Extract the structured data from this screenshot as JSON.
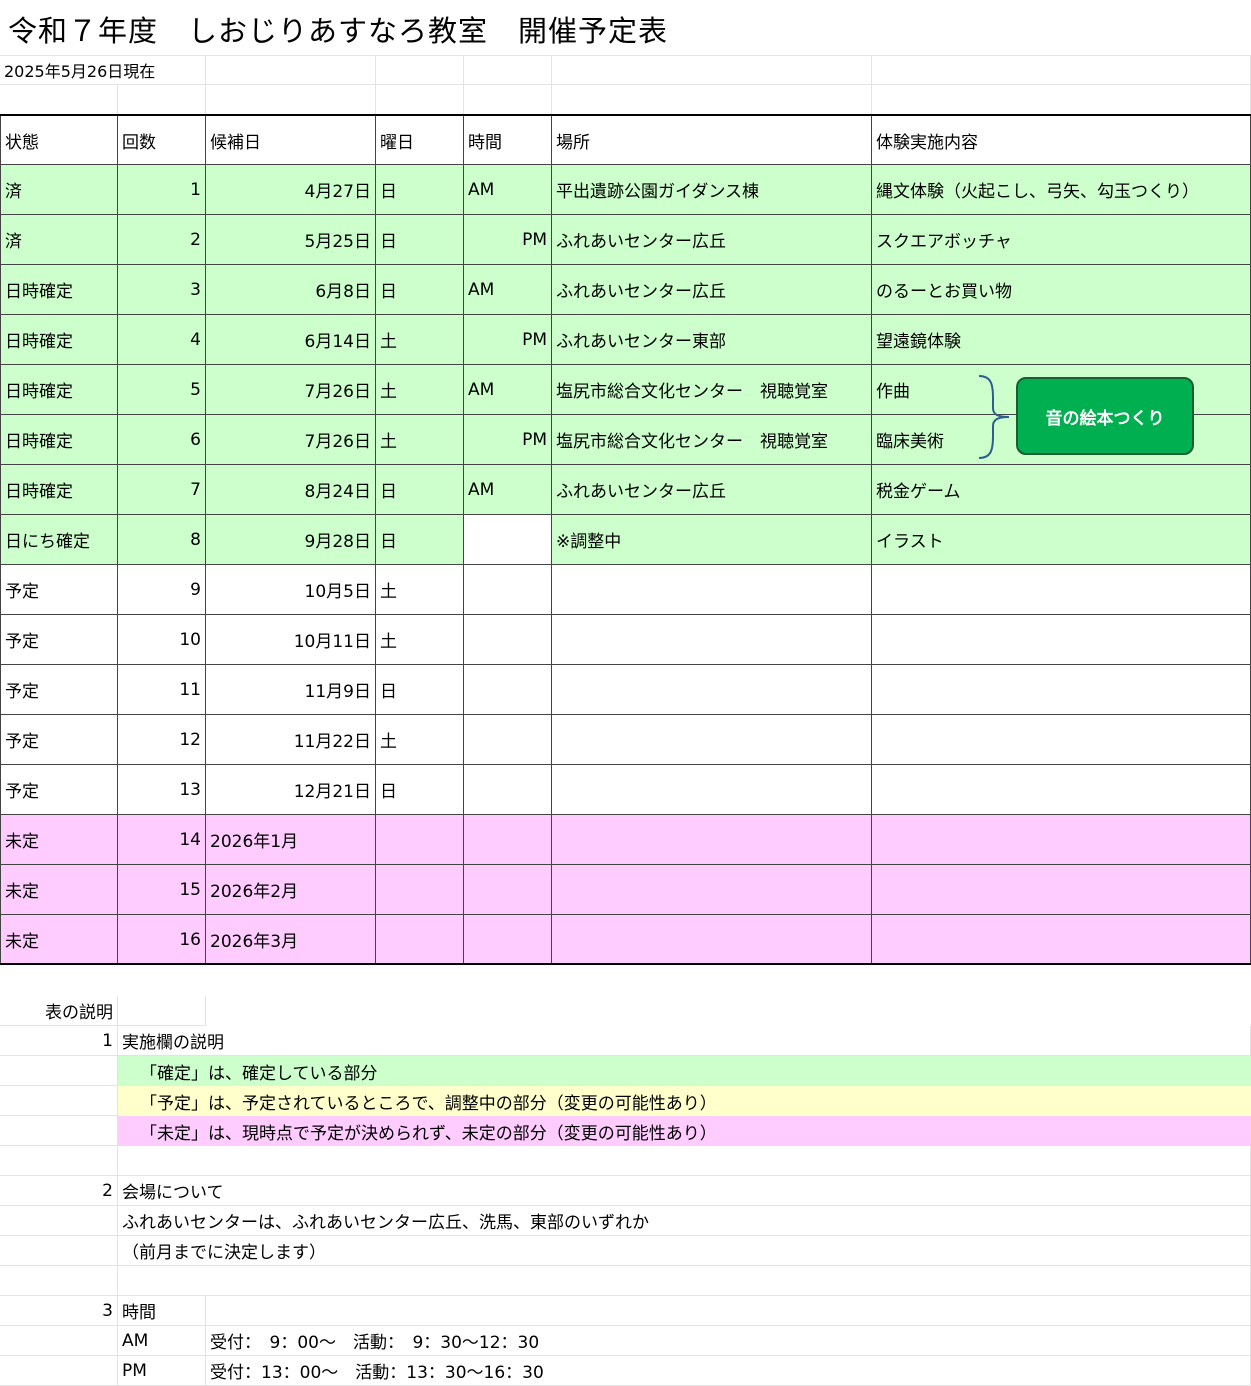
{
  "title": "令和７年度　しおじりあすなろ教室　開催予定表",
  "as_of": "2025年5月26日現在",
  "headers": [
    "状態",
    "回数",
    "候補日",
    "曜日",
    "時間",
    "場所",
    "体験実施内容"
  ],
  "rows": [
    {
      "status": "済",
      "no": "1",
      "date": "4月27日",
      "dow": "日",
      "am": "AM",
      "pm": "",
      "place": "平出遺跡公園ガイダンス棟",
      "content": "縄文体験（火起こし、弓矢、勾玉つくり）",
      "color": "green"
    },
    {
      "status": "済",
      "no": "2",
      "date": "5月25日",
      "dow": "日",
      "am": "",
      "pm": "PM",
      "place": "ふれあいセンター広丘",
      "content": "スクエアボッチャ",
      "color": "green"
    },
    {
      "status": "日時確定",
      "no": "3",
      "date": "6月8日",
      "dow": "日",
      "am": "AM",
      "pm": "",
      "place": "ふれあいセンター広丘",
      "content": "のるーとお買い物",
      "color": "green"
    },
    {
      "status": "日時確定",
      "no": "4",
      "date": "6月14日",
      "dow": "土",
      "am": "",
      "pm": "PM",
      "place": "ふれあいセンター東部",
      "content": "望遠鏡体験",
      "color": "green"
    },
    {
      "status": "日時確定",
      "no": "5",
      "date": "7月26日",
      "dow": "土",
      "am": "AM",
      "pm": "",
      "place": "塩尻市総合文化センター　視聴覚室",
      "content": "作曲",
      "color": "green"
    },
    {
      "status": "日時確定",
      "no": "6",
      "date": "7月26日",
      "dow": "土",
      "am": "",
      "pm": "PM",
      "place": "塩尻市総合文化センター　視聴覚室",
      "content": "臨床美術",
      "color": "green"
    },
    {
      "status": "日時確定",
      "no": "7",
      "date": "8月24日",
      "dow": "日",
      "am": "AM",
      "pm": "",
      "place": "ふれあいセンター広丘",
      "content": "税金ゲーム",
      "color": "green"
    },
    {
      "status": "日にち確定",
      "no": "8",
      "date": "9月28日",
      "dow": "日",
      "am": "",
      "pm": "",
      "place": "※調整中",
      "content": "イラスト",
      "color": "green-partial"
    },
    {
      "status": "予定",
      "no": "9",
      "date": "10月5日",
      "dow": "土",
      "am": "",
      "pm": "",
      "place": "",
      "content": "",
      "color": "white"
    },
    {
      "status": "予定",
      "no": "10",
      "date": "10月11日",
      "dow": "土",
      "am": "",
      "pm": "",
      "place": "",
      "content": "",
      "color": "white"
    },
    {
      "status": "予定",
      "no": "11",
      "date": "11月9日",
      "dow": "日",
      "am": "",
      "pm": "",
      "place": "",
      "content": "",
      "color": "white"
    },
    {
      "status": "予定",
      "no": "12",
      "date": "11月22日",
      "dow": "土",
      "am": "",
      "pm": "",
      "place": "",
      "content": "",
      "color": "white"
    },
    {
      "status": "予定",
      "no": "13",
      "date": "12月21日",
      "dow": "日",
      "am": "",
      "pm": "",
      "place": "",
      "content": "",
      "color": "white"
    },
    {
      "status": "未定",
      "no": "14",
      "date": "2026年1月",
      "dow": "",
      "am": "",
      "pm": "",
      "place": "",
      "content": "",
      "color": "pink"
    },
    {
      "status": "未定",
      "no": "15",
      "date": "2026年2月",
      "dow": "",
      "am": "",
      "pm": "",
      "place": "",
      "content": "",
      "color": "pink"
    },
    {
      "status": "未定",
      "no": "16",
      "date": "2026年3月",
      "dow": "",
      "am": "",
      "pm": "",
      "place": "",
      "content": "",
      "color": "pink"
    }
  ],
  "callout": "音の絵本つくり",
  "notes": {
    "heading": "表の説明",
    "n1": "1",
    "n1_title": "実施欄の説明",
    "n1_green": "「確定」は、確定している部分",
    "n1_yellow": "「予定」は、予定されているところで、調整中の部分（変更の可能性あり）",
    "n1_pink": "「未定」は、現時点で予定が決められず、未定の部分（変更の可能性あり）",
    "n2": "2",
    "n2_title": "会場について",
    "n2_line1": "ふれあいセンターは、ふれあいセンター広丘、洗馬、東部のいずれか",
    "n2_line2": "（前月までに決定します）",
    "n3": "3",
    "n3_title": "時間",
    "am_label": "AM",
    "am_time": "受付：　9：00～　活動：　9：30～12：30",
    "pm_label": "PM",
    "pm_time": "受付：13：00～　活動：13：30～16：30"
  },
  "colors": {
    "confirmed": "#ccffcc",
    "planned": "#ffffcc",
    "undecided": "#ffccff",
    "callout": "#00b050"
  }
}
